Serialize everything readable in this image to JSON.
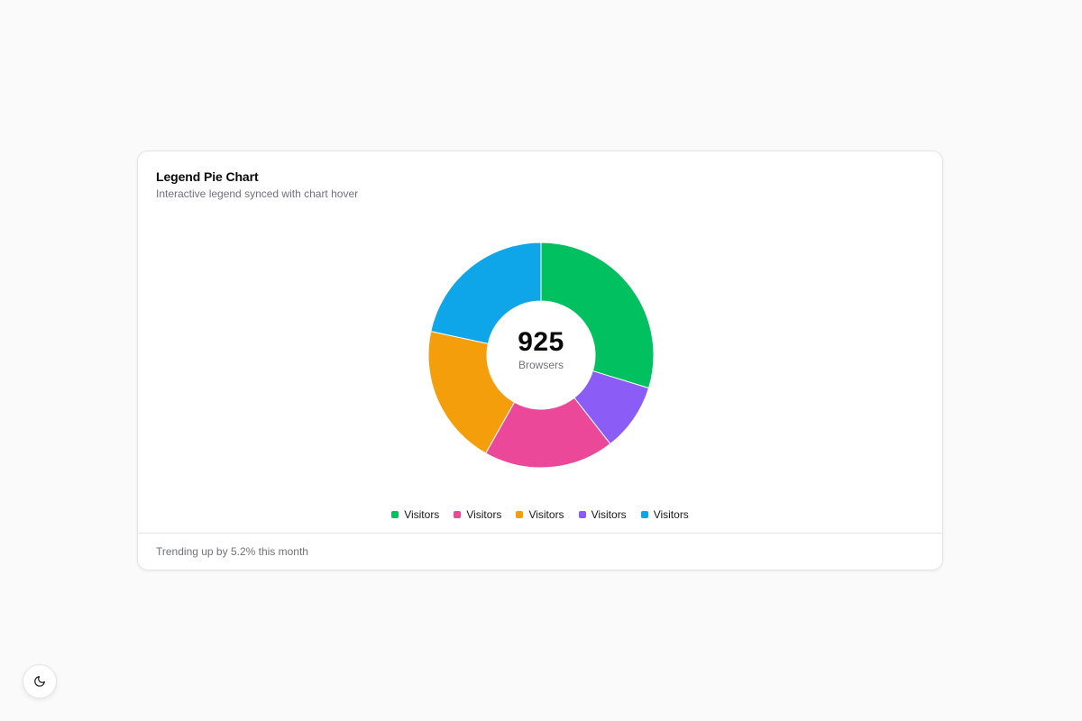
{
  "card": {
    "title": "Legend Pie Chart",
    "subtitle": "Interactive legend synced with chart hover",
    "footer": "Trending up by 5.2% this month"
  },
  "center": {
    "value": "925",
    "caption": "Browsers"
  },
  "theme_toggle": {
    "icon": "moon-icon"
  },
  "chart_data": {
    "type": "pie",
    "variant": "donut",
    "total": 925,
    "start_angle_deg": 0,
    "series": [
      {
        "name": "Visitors",
        "value": 275,
        "color": "#00c060"
      },
      {
        "name": "Visitors",
        "value": 90,
        "color": "#8b5cf6"
      },
      {
        "name": "Visitors",
        "value": 173,
        "color": "#ec4899"
      },
      {
        "name": "Visitors",
        "value": 187,
        "color": "#f59e0b"
      },
      {
        "name": "Visitors",
        "value": 200,
        "color": "#0ea5e9"
      }
    ],
    "legend": {
      "placement": "bottom",
      "order": [
        0,
        2,
        3,
        1,
        4
      ]
    }
  }
}
